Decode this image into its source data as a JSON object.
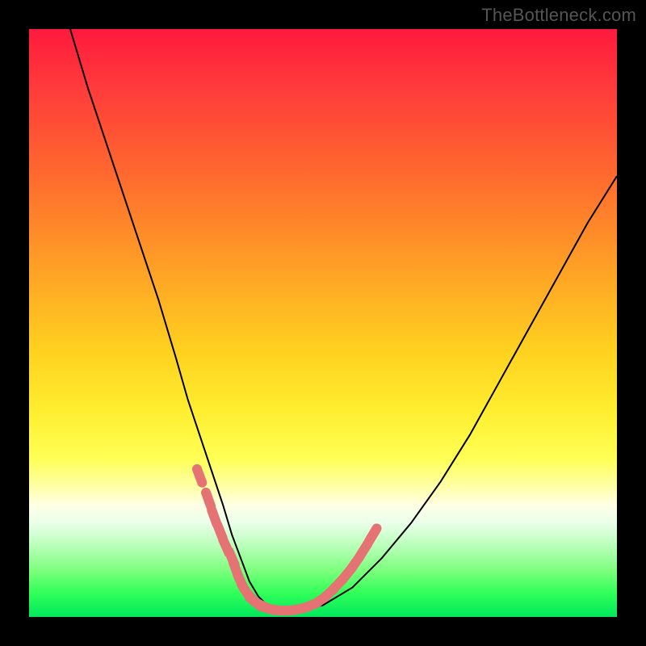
{
  "watermark": "TheBottleneck.com",
  "colors": {
    "frame": "#000000",
    "curve": "#000000",
    "marker": "#e57373",
    "gradient_stops": [
      "#ff1a3d",
      "#ff3b3b",
      "#ff6a2e",
      "#ff9e26",
      "#ffd21f",
      "#ffee30",
      "#ffff55",
      "#ffffaa",
      "#ffffe5",
      "#eaffea",
      "#b8ffb8",
      "#7fff7f",
      "#30ff59",
      "#00e85c"
    ]
  },
  "chart_data": {
    "type": "line",
    "title": "",
    "xlabel": "",
    "ylabel": "",
    "xlim": [
      0,
      100
    ],
    "ylim": [
      0,
      100
    ],
    "grid": false,
    "legend": false,
    "series": [
      {
        "name": "bottleneck-curve",
        "x": [
          7,
          10,
          14,
          18,
          22,
          25,
          27,
          29,
          31,
          33,
          34.5,
          36,
          37.5,
          39,
          40.5,
          43,
          46,
          50,
          55,
          60,
          65,
          70,
          75,
          80,
          85,
          90,
          95,
          100
        ],
        "y": [
          100,
          90,
          78,
          66,
          54,
          44,
          37,
          31,
          25,
          19,
          14,
          10,
          6,
          3.5,
          2,
          1,
          1,
          2,
          5,
          10,
          16,
          23,
          31,
          40,
          49,
          58,
          67,
          75
        ]
      }
    ],
    "markers": {
      "name": "highlight-dots",
      "x": [
        29,
        30.5,
        31.5,
        32.5,
        33.5,
        34.5,
        35.2,
        36,
        36.8,
        37.6,
        38.5,
        39.5,
        40.5,
        42,
        43.5,
        45,
        46.5,
        48,
        49.5,
        51,
        52.5,
        54,
        55.5,
        57,
        58.5
      ],
      "y": [
        24,
        20,
        17,
        14.5,
        12,
        10,
        8,
        6,
        4.5,
        3.5,
        2.5,
        2,
        1.5,
        1.2,
        1.1,
        1.2,
        1.5,
        2,
        2.8,
        4,
        5.5,
        7.2,
        9.2,
        11.5,
        14
      ]
    }
  }
}
